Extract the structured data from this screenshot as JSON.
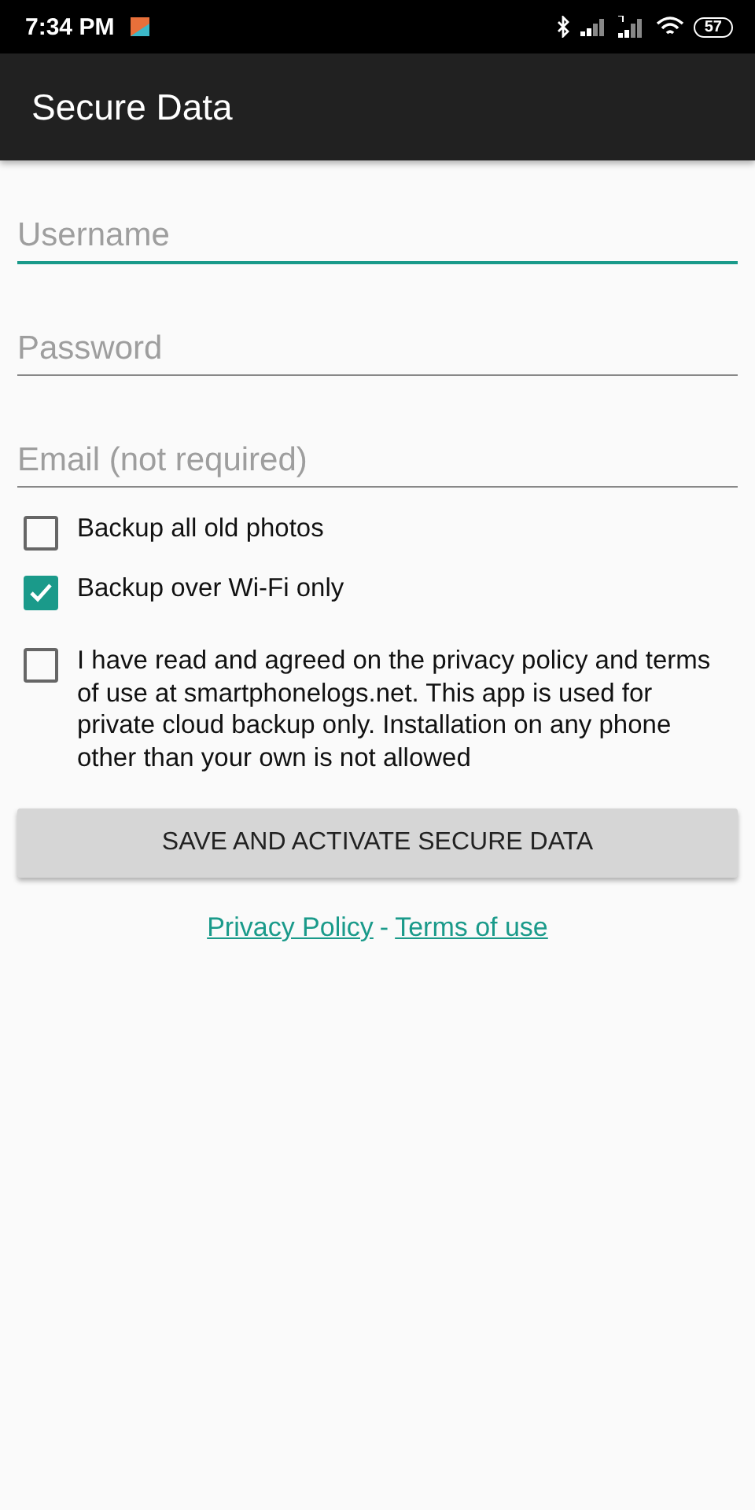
{
  "status_bar": {
    "time": "7:34 PM",
    "battery": "57"
  },
  "app_bar": {
    "title": "Secure Data"
  },
  "fields": [
    {
      "placeholder": "Username",
      "focused": true
    },
    {
      "placeholder": "Password",
      "focused": false
    },
    {
      "placeholder": "Email (not required)",
      "focused": false
    }
  ],
  "checkboxes": [
    {
      "label": "Backup all old photos",
      "checked": false
    },
    {
      "label": "Backup over Wi-Fi only",
      "checked": true
    },
    {
      "label": "I have read and agreed on the privacy policy and terms of use at smartphonelogs.net. This app is used for private cloud backup only. Installation on any phone other than your own is not allowed",
      "checked": false
    }
  ],
  "button": "SAVE AND ACTIVATE SECURE DATA",
  "links": {
    "first": "Privacy Policy",
    "separator": "-",
    "second": "Terms of use"
  }
}
